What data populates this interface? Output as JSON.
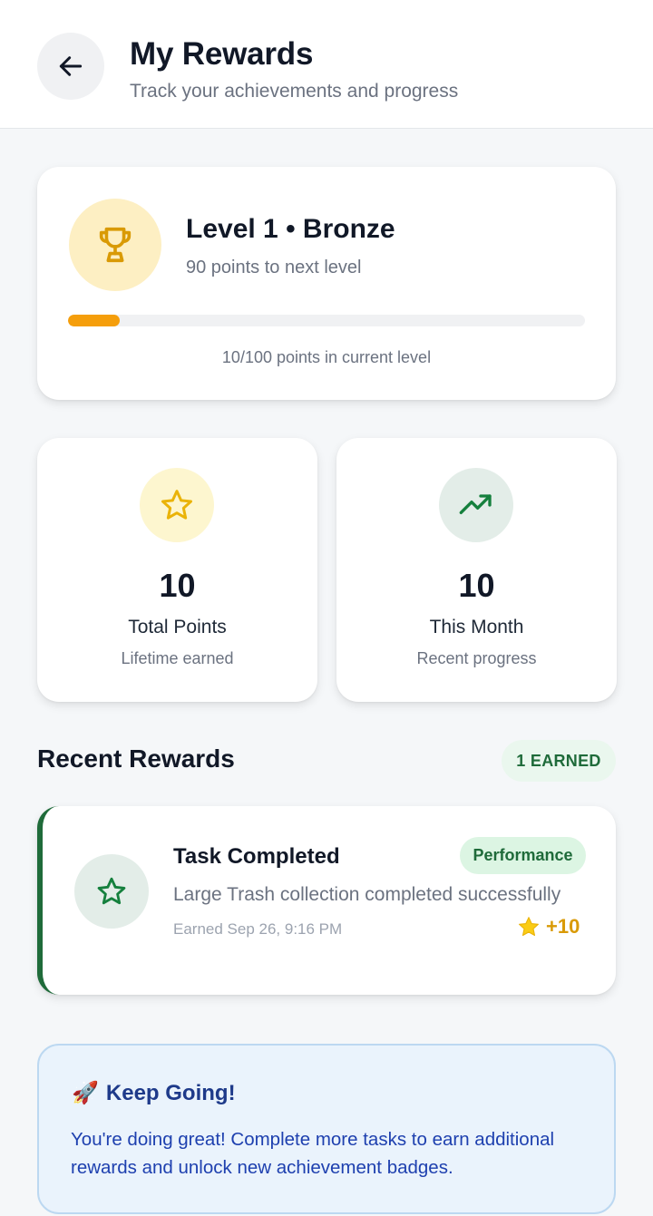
{
  "header": {
    "title": "My Rewards",
    "subtitle": "Track your achievements and progress",
    "back_icon": "arrow-left-icon"
  },
  "level": {
    "title": "Level 1 • Bronze",
    "next_level_text": "90 points to next level",
    "progress_caption": "10/100 points in current level",
    "progress_fraction": 0.1,
    "icon": "trophy-icon",
    "accent_color": "#f59e0b"
  },
  "stats": [
    {
      "value": "10",
      "label": "Total Points",
      "sub": "Lifetime earned",
      "icon": "star-icon",
      "icon_bg": "#fdf6cf",
      "icon_color": "#eab308"
    },
    {
      "value": "10",
      "label": "This Month",
      "sub": "Recent progress",
      "icon": "trending-up-icon",
      "icon_bg": "#e3ede8",
      "icon_color": "#15803d"
    }
  ],
  "recent": {
    "title": "Recent Rewards",
    "earned_badge": "1 EARNED",
    "items": [
      {
        "title": "Task Completed",
        "description": "Large Trash collection completed successfully",
        "date": "Earned Sep 26, 9:16 PM",
        "category": "Performance",
        "points": "+10",
        "icon": "star-outline-icon"
      }
    ]
  },
  "tip": {
    "emoji": "🚀",
    "title": "Keep Going!",
    "text": "You're doing great! Complete more tasks to earn additional rewards and unlock new achievement badges."
  }
}
